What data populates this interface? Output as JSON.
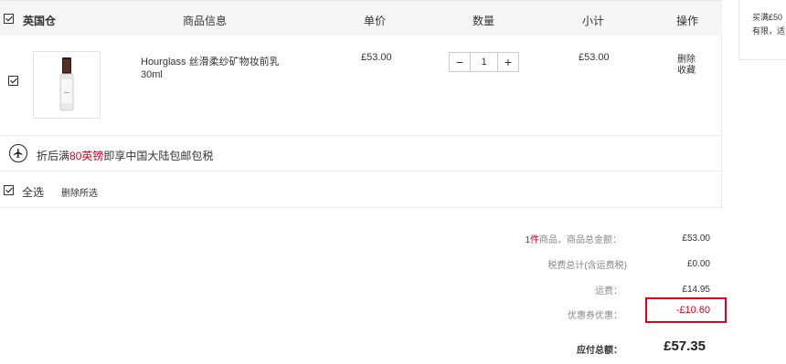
{
  "header": {
    "warehouse": "英国仓",
    "col_product": "商品信息",
    "col_price": "单价",
    "col_qty": "数量",
    "col_subtotal": "小计",
    "col_action": "操作"
  },
  "item": {
    "name_line1": "Hourglass 丝滑柔纱矿物妆前乳",
    "name_line2": "30ml",
    "price": "£53.00",
    "quantity": "1",
    "subtotal": "£53.00",
    "action_delete": "删除",
    "action_save": "收藏",
    "minus": "−",
    "plus": "+"
  },
  "promo": {
    "prefix": "折后满",
    "amount": "80英镑",
    "suffix": "即享中国大陆包邮包税"
  },
  "footer": {
    "select_all": "全选",
    "delete_selected": "删除所选"
  },
  "summary": {
    "count_highlight": "1件",
    "count_label": "商品，商品总金额：",
    "subtotal": "£53.00",
    "tax_label": "税费总计(含运费税)",
    "tax": "£0.00",
    "shipping_label": "运费：",
    "shipping": "£14.95",
    "coupon_label": "优惠券优惠：",
    "coupon": "-£10.60",
    "total_label": "应付总额：",
    "total": "£57.35"
  },
  "side": {
    "line1": "买满£50",
    "line2": "有限，适"
  },
  "colors": {
    "accent_red": "#e0001b",
    "header_bg": "#f5f5f5"
  }
}
